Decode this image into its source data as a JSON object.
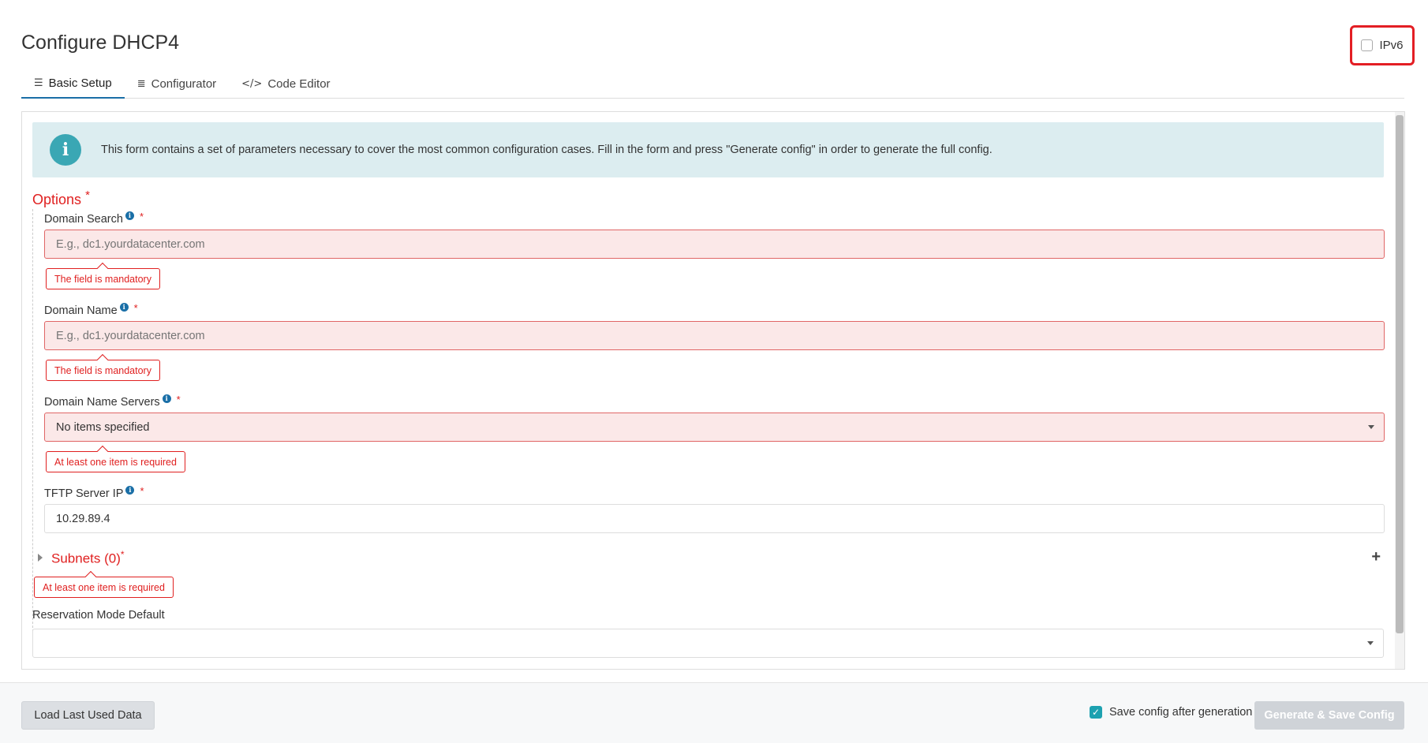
{
  "page": {
    "title": "Configure DHCP4"
  },
  "ipv6": {
    "label": "IPv6",
    "checked": false
  },
  "tabs": [
    {
      "label": "Basic Setup",
      "icon": "list-check-icon",
      "active": true
    },
    {
      "label": "Configurator",
      "icon": "list-lines-icon",
      "active": false
    },
    {
      "label": "Code Editor",
      "icon": "code-icon",
      "active": false
    }
  ],
  "info": {
    "text": "This form contains a set of parameters necessary to cover the most common configuration cases. Fill in the form and press \"Generate config\" in order to generate the full config."
  },
  "options": {
    "title": "Options",
    "required_mark": "*",
    "fields": {
      "domain_search": {
        "label": "Domain Search",
        "placeholder": "E.g., dc1.yourdatacenter.com",
        "value": "",
        "error": "The field is mandatory"
      },
      "domain_name": {
        "label": "Domain Name",
        "placeholder": "E.g., dc1.yourdatacenter.com",
        "value": "",
        "error": "The field is mandatory"
      },
      "domain_name_servers": {
        "label": "Domain Name Servers",
        "value": "No items specified",
        "error": "At least one item is required"
      },
      "tftp_server_ip": {
        "label": "TFTP Server IP",
        "value": "10.29.89.4"
      }
    }
  },
  "subnets": {
    "title": "Subnets (0)",
    "required_mark": "*",
    "error": "At least one item is required",
    "add_symbol": "+"
  },
  "reservation_mode_default": {
    "label": "Reservation Mode Default",
    "value": ""
  },
  "footer": {
    "load_button": "Load Last Used Data",
    "save_after_label": "Save config after generation",
    "save_after_checked": true,
    "generate_button": "Generate & Save Config"
  },
  "colors": {
    "accent": "#1a6fa7",
    "error": "#e02020",
    "info_bg": "#dcedf0",
    "info_icon": "#3aa7b4",
    "highlight_box": "#e31e24"
  }
}
